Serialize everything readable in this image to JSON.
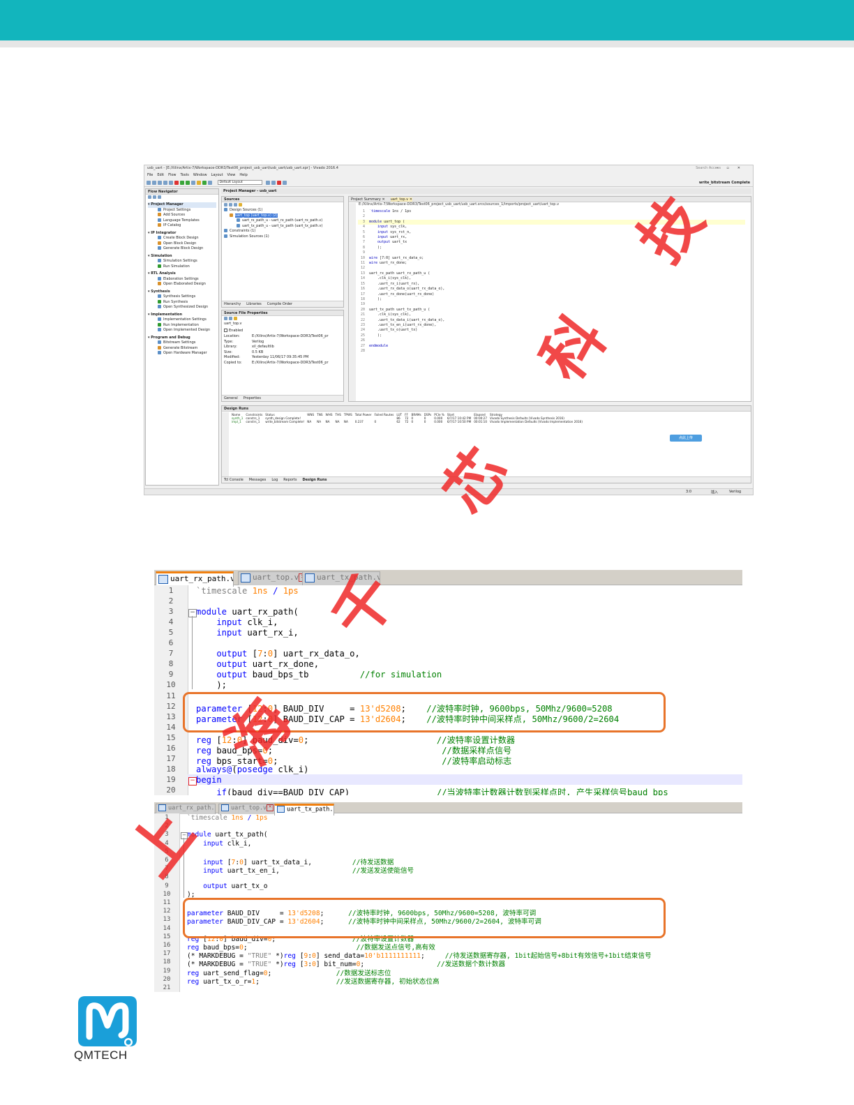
{
  "vivado": {
    "window_title": "usb_uart - [E:/Xilinx/Artix-7/Workspace-DDR3/Test06_project_usb_uart/usb_uart/usb_uart.xpr] - Vivado 2016.4",
    "search_placeholder": "Search Access",
    "menu": [
      "File",
      "Edit",
      "Flow",
      "Tools",
      "Window",
      "Layout",
      "View",
      "Help"
    ],
    "layout_select": "Default Layout",
    "status_complete": "write_bitstream Complete",
    "flow_navigator": {
      "title": "Flow Navigator",
      "sections": [
        {
          "name": "Project Manager",
          "items": [
            "Project Settings",
            "Add Sources",
            "Language Templates",
            "IP Catalog"
          ]
        },
        {
          "name": "IP Integrator",
          "items": [
            "Create Block Design",
            "Open Block Design",
            "Generate Block Design"
          ]
        },
        {
          "name": "Simulation",
          "items": [
            "Simulation Settings",
            "Run Simulation"
          ]
        },
        {
          "name": "RTL Analysis",
          "items": [
            "Elaboration Settings",
            "Open Elaborated Design"
          ]
        },
        {
          "name": "Synthesis",
          "items": [
            "Synthesis Settings",
            "Run Synthesis",
            "Open Synthesized Design"
          ]
        },
        {
          "name": "Implementation",
          "items": [
            "Implementation Settings",
            "Run Implementation",
            "Open Implemented Design"
          ]
        },
        {
          "name": "Program and Debug",
          "items": [
            "Bitstream Settings",
            "Generate Bitstream",
            "Open Hardware Manager"
          ]
        }
      ]
    },
    "project_manager_title": "Project Manager - usb_uart",
    "sources": {
      "title": "Sources",
      "tree": [
        "Design Sources (1)",
        "uart_top (uart_top.v) (2)",
        "uart_rx_path_u - uart_rx_path (uart_rx_path.v)",
        "uart_tx_path_u - uart_tx_path (uart_tx_path.v)",
        "Constraints (1)",
        "Simulation Sources (1)"
      ],
      "tabs": [
        "Hierarchy",
        "Libraries",
        "Compile Order"
      ]
    },
    "file_props": {
      "title": "Source File Properties",
      "file": "uart_top.v",
      "enabled": "Enabled",
      "rows": [
        {
          "k": "Location:",
          "v": "E:/Xilinx/Artix-7/Workspace-DDR3/Test06_pr"
        },
        {
          "k": "Type:",
          "v": "Verilog"
        },
        {
          "k": "Library:",
          "v": "xil_defaultlib"
        },
        {
          "k": "Size:",
          "v": "0.5 KB"
        },
        {
          "k": "Modified:",
          "v": "Yesterday 11/06/17 09:35:45 PM"
        },
        {
          "k": "Copied to:",
          "v": "E:/Xilinx/Artix-7/Workspace-DDR3/Test06_pr"
        }
      ],
      "tabs": [
        "General",
        "Properties"
      ]
    },
    "editor": {
      "tabs": [
        "Project Summary",
        "uart_top.v"
      ],
      "path": "E:/Xilinx/Artix-7/Workspace-DDR3/Test06_project_usb_uart/usb_uart.srcs/sources_1/imports/project_uart/uart_top.v",
      "lines": [
        "`timescale 1ns / 1ps",
        "",
        "module uart_top (",
        "    input sys_clk,",
        "    input sys_rst_n,",
        "    input uart_rx,",
        "    output uart_tx",
        "    );",
        "",
        "wire [7:0] uart_rx_data_o;",
        "wire uart_rx_done;",
        "",
        "uart_rx_path uart_rx_path_u (",
        "    .clk_i(sys_clk),",
        "    .uart_rx_i(uart_rx),",
        "    .uart_rx_data_o(uart_rx_data_o),",
        "    .uart_rx_done(uart_rx_done)",
        "    );",
        "",
        "uart_tx_path uart_tx_path_u (",
        "    .clk_i(sys_clk),",
        "    .uart_tx_data_i(uart_rx_data_o),",
        "    .uart_tx_en_i(uart_rx_done),",
        "    .uart_tx_o(uart_tx)",
        "    );",
        "",
        "endmodule",
        ""
      ]
    },
    "design_runs": {
      "title": "Design Runs",
      "headers": [
        "Name",
        "Constraints",
        "Status",
        "WNS",
        "TNS",
        "WHS",
        "THS",
        "TPWS",
        "Total Power",
        "Failed Routes",
        "LUT",
        "FF",
        "BRAMs",
        "DSPs",
        "PCIe %",
        "Start",
        "Elapsed",
        "Strategy"
      ],
      "rows": [
        [
          "synth_1",
          "constrs_1",
          "synth_design Complete!",
          "",
          "",
          "",
          "",
          "",
          "",
          "",
          "86",
          "72",
          "0",
          "0",
          "0.000",
          "6/7/17 10:42 PM",
          "00:00:27",
          "Vivado Synthesis Defaults (Vivado Synthesis 2016)"
        ],
        [
          "impl_1",
          "constrs_1",
          "write_bitstream Complete!",
          "NA",
          "NA",
          "NA",
          "NA",
          "NA",
          "0.237",
          "0",
          "62",
          "72",
          "0",
          "0",
          "0.000",
          "6/7/17 10:50 PM",
          "00:01:10",
          "Vivado Implementation Defaults (Vivado Implementation 2016)"
        ]
      ],
      "upload_button": "点此上传"
    },
    "bottom_tabs": [
      "Tcl Console",
      "Messages",
      "Log",
      "Reports",
      "Design Runs"
    ],
    "status_bar": {
      "pos": "3:0",
      "mode": "插入",
      "lang": "Verilog"
    }
  },
  "editor1": {
    "tabs": [
      "uart_rx_path.v",
      "uart_top.v",
      "uart_tx_path.v"
    ],
    "lines": [
      {
        "n": "1",
        "t": [
          [
            "st",
            "`timescale "
          ],
          [
            "nm",
            "1ns"
          ],
          [
            "kw",
            " / "
          ],
          [
            "nm",
            "1ps"
          ]
        ]
      },
      {
        "n": "2",
        "t": []
      },
      {
        "n": "3",
        "t": [
          [
            "kw",
            "module"
          ],
          [
            "",
            " uart_rx_path("
          ]
        ]
      },
      {
        "n": "4",
        "t": [
          [
            "kw",
            "    input"
          ],
          [
            "",
            " clk_i,"
          ]
        ]
      },
      {
        "n": "5",
        "t": [
          [
            "kw",
            "    input"
          ],
          [
            "",
            " uart_rx_i,"
          ]
        ]
      },
      {
        "n": "6",
        "t": []
      },
      {
        "n": "7",
        "t": [
          [
            "kw",
            "    output"
          ],
          [
            "",
            " ["
          ],
          [
            "nm",
            "7"
          ],
          [
            "",
            ":"
          ],
          [
            "nm",
            "0"
          ],
          [
            "",
            "] uart_rx_data_o,"
          ]
        ]
      },
      {
        "n": "8",
        "t": [
          [
            "kw",
            "    output"
          ],
          [
            "",
            " uart_rx_done,"
          ]
        ]
      },
      {
        "n": "9",
        "t": [
          [
            "kw",
            "    output"
          ],
          [
            "",
            " baud_bps_tb          "
          ],
          [
            "cm",
            "//for simulation"
          ]
        ]
      },
      {
        "n": "10",
        "t": [
          [
            "",
            "    );"
          ]
        ]
      },
      {
        "n": "11",
        "t": []
      },
      {
        "n": "12",
        "t": [
          [
            "kw",
            "parameter"
          ],
          [
            "",
            " ["
          ],
          [
            "nm",
            "12"
          ],
          [
            "",
            ":"
          ],
          [
            "nm",
            "0"
          ],
          [
            "",
            "] BAUD_DIV     = "
          ],
          [
            "nm",
            "13'd5208"
          ],
          [
            "",
            ";    "
          ],
          [
            "cm",
            "//波特率时钟, 9600bps, 50Mhz/9600=5208"
          ]
        ]
      },
      {
        "n": "13",
        "t": [
          [
            "kw",
            "parameter"
          ],
          [
            "",
            " ["
          ],
          [
            "nm",
            "12"
          ],
          [
            "",
            ":"
          ],
          [
            "nm",
            "0"
          ],
          [
            "",
            "] BAUD_DIV_CAP = "
          ],
          [
            "nm",
            "13'd2604"
          ],
          [
            "",
            ";    "
          ],
          [
            "cm",
            "//波特率时钟中间采样点, 50Mhz/9600/2=2604"
          ]
        ]
      },
      {
        "n": "14",
        "t": []
      },
      {
        "n": "15",
        "t": [
          [
            "kw",
            "reg"
          ],
          [
            "",
            " ["
          ],
          [
            "nm",
            "12"
          ],
          [
            "",
            ":"
          ],
          [
            "nm",
            "0"
          ],
          [
            "",
            "] baud_div="
          ],
          [
            "nm",
            "0"
          ],
          [
            "",
            ";                         "
          ],
          [
            "cm",
            "//波特率设置计数器"
          ]
        ]
      },
      {
        "n": "16",
        "t": [
          [
            "kw",
            "reg"
          ],
          [
            "",
            " baud_bps="
          ],
          [
            "nm",
            "0"
          ],
          [
            "",
            ";                                 "
          ],
          [
            "cm",
            "//数据采样点信号"
          ]
        ]
      },
      {
        "n": "17",
        "t": [
          [
            "kw",
            "reg"
          ],
          [
            "",
            " bps_start="
          ],
          [
            "nm",
            "0"
          ],
          [
            "",
            ";                                "
          ],
          [
            "cm",
            "//波特率启动标志"
          ]
        ]
      },
      {
        "n": "18",
        "t": [
          [
            "kw",
            "always@"
          ],
          [
            "",
            "("
          ],
          [
            "kw",
            "posedge"
          ],
          [
            "",
            " clk_i)"
          ]
        ]
      },
      {
        "n": "19",
        "t": [
          [
            "kw",
            "begin"
          ]
        ]
      },
      {
        "n": "20",
        "t": [
          [
            "kw",
            "    if"
          ],
          [
            "",
            "(baud_div==BAUD_DIV_CAP)                 "
          ],
          [
            "cm",
            "//当波特率计数器计数到采样点时, 产生采样信号baud_bps"
          ]
        ]
      }
    ]
  },
  "editor2": {
    "tabs": [
      "uart_rx_path.v",
      "uart_top.v",
      "uart_tx_path.v"
    ],
    "lines": [
      {
        "n": "1",
        "t": [
          [
            "st",
            "`timescale "
          ],
          [
            "nm",
            "1ns"
          ],
          [
            "kw",
            " / "
          ],
          [
            "nm",
            "1ps"
          ]
        ]
      },
      {
        "n": "2",
        "t": []
      },
      {
        "n": "3",
        "t": [
          [
            "kw",
            "module"
          ],
          [
            "",
            " uart_tx_path("
          ]
        ]
      },
      {
        "n": "4",
        "t": [
          [
            "kw",
            "    input"
          ],
          [
            "",
            " clk_i,"
          ]
        ]
      },
      {
        "n": "5",
        "t": []
      },
      {
        "n": "6",
        "t": [
          [
            "kw",
            "    input"
          ],
          [
            "",
            " ["
          ],
          [
            "nm",
            "7"
          ],
          [
            "",
            ":"
          ],
          [
            "nm",
            "0"
          ],
          [
            "",
            "] uart_tx_data_i,          "
          ],
          [
            "cm",
            "//待发送数据"
          ]
        ]
      },
      {
        "n": "7",
        "t": [
          [
            "kw",
            "    input"
          ],
          [
            "",
            " uart_tx_en_i,                  "
          ],
          [
            "cm",
            "//发送发送使能信号"
          ]
        ]
      },
      {
        "n": "8",
        "t": []
      },
      {
        "n": "9",
        "t": [
          [
            "kw",
            "    output"
          ],
          [
            "",
            " uart_tx_o"
          ]
        ]
      },
      {
        "n": "10",
        "t": [
          [
            "",
            ");"
          ]
        ]
      },
      {
        "n": "11",
        "t": []
      },
      {
        "n": "12",
        "t": [
          [
            "kw",
            "parameter"
          ],
          [
            "",
            " BAUD_DIV     = "
          ],
          [
            "nm",
            "13'd5208"
          ],
          [
            "",
            ";      "
          ],
          [
            "cm",
            "//波特率时钟, 9600bps, 50Mhz/9600=5208, 波特率可调"
          ]
        ]
      },
      {
        "n": "13",
        "t": [
          [
            "kw",
            "parameter"
          ],
          [
            "",
            " BAUD_DIV_CAP = "
          ],
          [
            "nm",
            "13'd2604"
          ],
          [
            "",
            ";      "
          ],
          [
            "cm",
            "//波特率时钟中间采样点, 50Mhz/9600/2=2604, 波特率可调"
          ]
        ]
      },
      {
        "n": "14",
        "t": []
      },
      {
        "n": "15",
        "t": [
          [
            "kw",
            "reg"
          ],
          [
            "",
            " ["
          ],
          [
            "nm",
            "12"
          ],
          [
            "",
            ":"
          ],
          [
            "nm",
            "0"
          ],
          [
            "",
            "] baud_div="
          ],
          [
            "nm",
            "0"
          ],
          [
            "",
            ";                   "
          ],
          [
            "cm",
            "//波特率设置计数器"
          ]
        ]
      },
      {
        "n": "16",
        "t": [
          [
            "kw",
            "reg"
          ],
          [
            "",
            " baud_bps="
          ],
          [
            "nm",
            "0"
          ],
          [
            "",
            ";                           "
          ],
          [
            "cm",
            "//数据发送点信号,高有效"
          ]
        ]
      },
      {
        "n": "17",
        "t": [
          [
            "",
            "(* MARKDEBUG = "
          ],
          [
            "st",
            "\"TRUE\""
          ],
          [
            "",
            " *)"
          ],
          [
            "kw",
            "reg"
          ],
          [
            "",
            " ["
          ],
          [
            "nm",
            "9"
          ],
          [
            "",
            ":"
          ],
          [
            "nm",
            "0"
          ],
          [
            "",
            "] send_data="
          ],
          [
            "nm",
            "10'b1111111111"
          ],
          [
            "",
            ";     "
          ],
          [
            "cm",
            "//待发送数据寄存器, 1bit起始信号+8bit有效信号+1bit结束信号"
          ]
        ]
      },
      {
        "n": "18",
        "t": [
          [
            "",
            "(* MARKDEBUG = "
          ],
          [
            "st",
            "\"TRUE\""
          ],
          [
            "",
            " *)"
          ],
          [
            "kw",
            "reg"
          ],
          [
            "",
            " ["
          ],
          [
            "nm",
            "3"
          ],
          [
            "",
            ":"
          ],
          [
            "nm",
            "0"
          ],
          [
            "",
            "] bit_num="
          ],
          [
            "nm",
            "0"
          ],
          [
            "",
            ";                  "
          ],
          [
            "cm",
            "//发送数据个数计数器"
          ]
        ]
      },
      {
        "n": "19",
        "t": [
          [
            "kw",
            "reg"
          ],
          [
            "",
            " uart_send_flag="
          ],
          [
            "nm",
            "0"
          ],
          [
            "",
            ";                "
          ],
          [
            "cm",
            "//数据发送标志位"
          ]
        ]
      },
      {
        "n": "20",
        "t": [
          [
            "kw",
            "reg"
          ],
          [
            "",
            " uart_tx_o_r="
          ],
          [
            "nm",
            "1"
          ],
          [
            "",
            ";                   "
          ],
          [
            "cm",
            "//发送数据寄存器, 初始状态位高"
          ]
        ]
      },
      {
        "n": "21",
        "t": []
      }
    ]
  },
  "watermark": "上海千芯科技",
  "logo": {
    "text": "QMTECH",
    "color": "#1a9fd9"
  },
  "colors": {
    "header": "#12b5bd",
    "highlight_box": "#e8742a",
    "watermark": "#ee2828"
  }
}
